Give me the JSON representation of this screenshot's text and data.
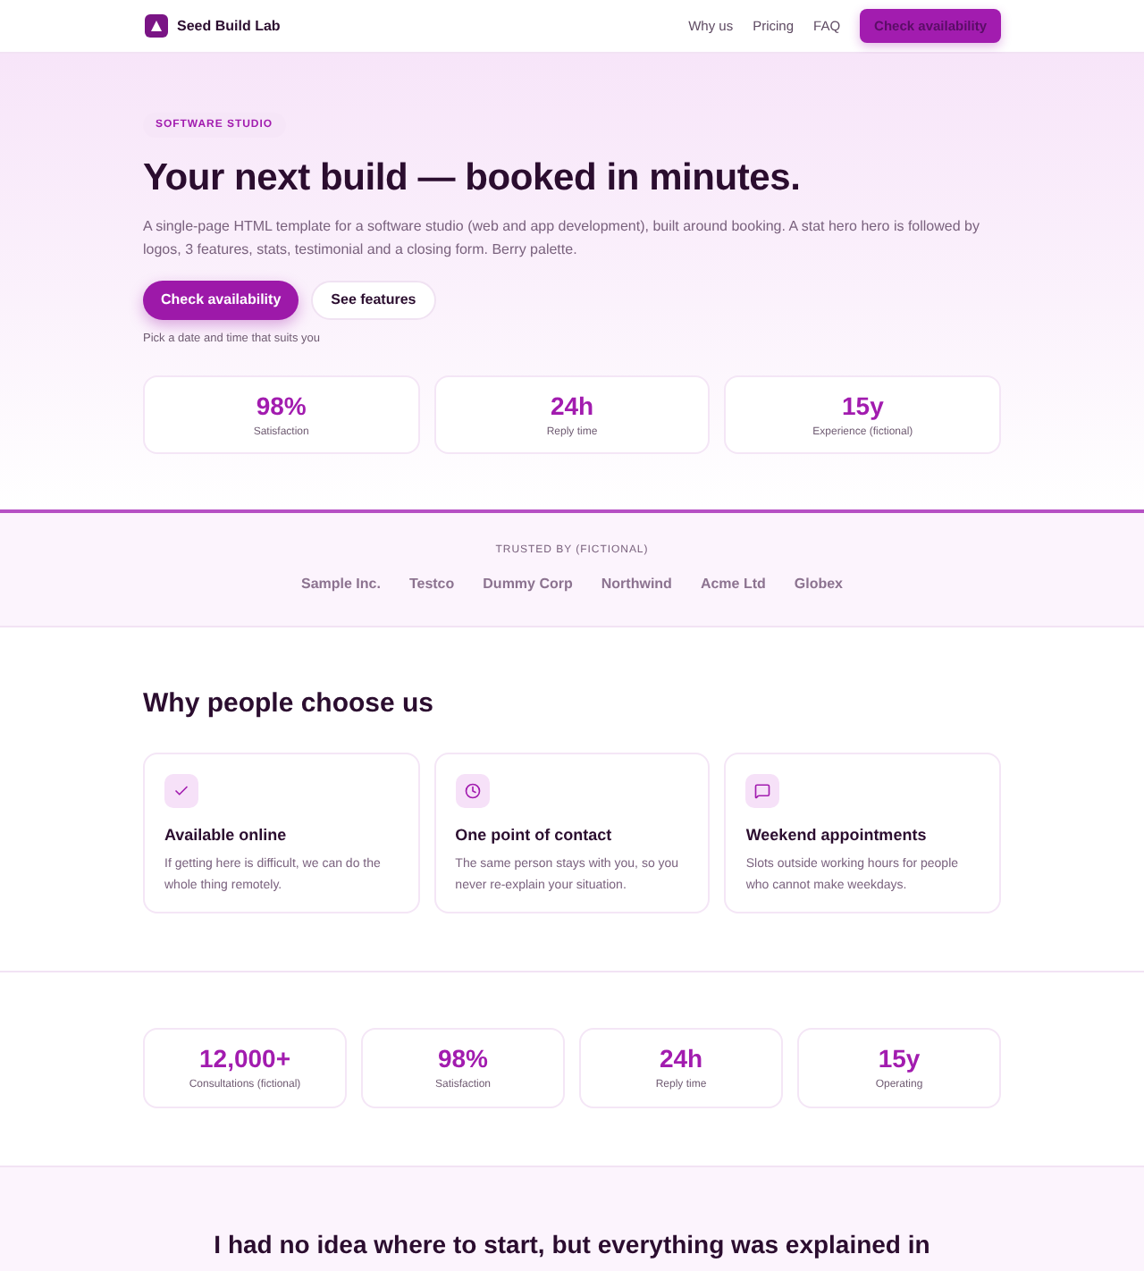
{
  "header": {
    "brand": "Seed Build Lab",
    "nav": [
      "Why us",
      "Pricing",
      "FAQ"
    ],
    "cta": "Check availability"
  },
  "hero": {
    "eyebrow": "SOFTWARE STUDIO",
    "title": "Your next build — booked in minutes.",
    "lead": "A single-page HTML template for a software studio (web and app development), built around booking. A stat hero hero is followed by logos, 3 features, stats, testimonial and a closing form. Berry palette.",
    "buttons": [
      {
        "label": "Check availability",
        "kind": "primary"
      },
      {
        "label": "See features",
        "kind": "secondary"
      }
    ],
    "note": "Pick a date and time that suits you",
    "stats": [
      {
        "value": "98%",
        "label": "Satisfaction"
      },
      {
        "value": "24h",
        "label": "Reply time"
      },
      {
        "value": "15y",
        "label": "Experience (fictional)"
      }
    ]
  },
  "logos": {
    "heading": "TRUSTED BY (FICTIONAL)",
    "items": [
      "Sample Inc.",
      "Testco",
      "Dummy Corp",
      "Northwind",
      "Acme Ltd",
      "Globex"
    ]
  },
  "features": {
    "title": "Why people choose us",
    "items": [
      {
        "title": "Available online",
        "text": "If getting here is difficult, we can do the whole thing remotely."
      },
      {
        "title": "One point of contact",
        "text": "The same person stays with you, so you never re-explain your situation."
      },
      {
        "title": "Weekend appointments",
        "text": "Slots outside working hours for people who cannot make weekdays."
      }
    ]
  },
  "stats": [
    {
      "value": "12,000+",
      "label": "Consultations (fictional)"
    },
    {
      "value": "98%",
      "label": "Satisfaction"
    },
    {
      "value": "24h",
      "label": "Reply time"
    },
    {
      "value": "15y",
      "label": "Operating"
    }
  ],
  "testimonial": {
    "quote": "I had no idea where to start, but everything was explained in"
  }
}
